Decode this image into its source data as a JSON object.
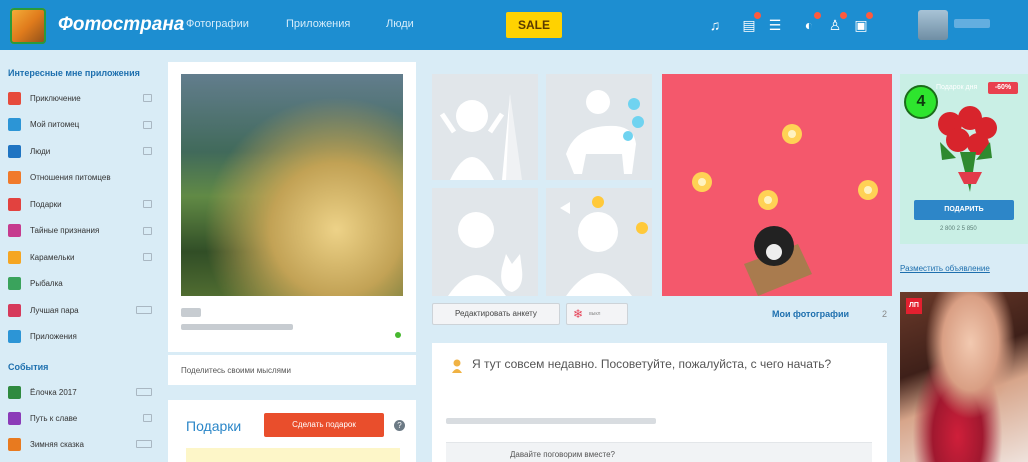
{
  "header": {
    "logo_text": "Фотострана",
    "nav": [
      "Фотографии",
      "Приложения",
      "Люди"
    ],
    "sale_label": "SALE",
    "icons": [
      "music-icon",
      "messages-icon",
      "list-icon",
      "bell-icon",
      "friends-icon",
      "mail-icon"
    ]
  },
  "sidebar": {
    "apps_heading": "Интересные мне приложения",
    "apps": [
      {
        "label": "Приключение",
        "icon_color": "#e64b3c"
      },
      {
        "label": "Мой питомец",
        "icon_color": "#2c95d6"
      },
      {
        "label": "Люди",
        "icon_color": "#1f74c2"
      },
      {
        "label": "Отношения питомцев",
        "icon_color": "#f07a2b"
      },
      {
        "label": "Подарки",
        "icon_color": "#e2423f"
      },
      {
        "label": "Тайные признания",
        "icon_color": "#c63b8e"
      },
      {
        "label": "Карамельки",
        "icon_color": "#f5a623"
      },
      {
        "label": "Рыбалка",
        "icon_color": "#3aa35c"
      },
      {
        "label": "Лучшая пара",
        "icon_color": "#d63a5b"
      },
      {
        "label": "Приложения",
        "icon_color": "#2c95d6"
      }
    ],
    "events_heading": "События",
    "events": [
      {
        "label": "Ёлочка 2017",
        "icon_color": "#2f8a3f"
      },
      {
        "label": "Путь к славе",
        "icon_color": "#8b3bb8"
      },
      {
        "label": "Зимняя сказка",
        "icon_color": "#e87a1f"
      }
    ]
  },
  "profile": {
    "share_prompt": "Поделитесь своими мыслями",
    "gifts_title": "Подарки",
    "make_gift_button": "Сделать подарок",
    "help_icon": "?"
  },
  "photos": {
    "edit_profile_button": "Редактировать анкету",
    "edit_mini_label": "выкл",
    "my_photos_link": "Мои фотографии",
    "my_photos_count": "2"
  },
  "feed": {
    "message": "Я тут совсем недавно. Посоветуйте, пожалуйста, с чего начать?",
    "inner_prompt": "Давайте поговорим вместе?"
  },
  "promo": {
    "title": "Подарок дня",
    "discount": "-60%",
    "step_number": "4",
    "present_button": "ПОДАРИТЬ",
    "price": "2 800 2 5 850",
    "ad_link": "Разместить объявление",
    "ad_logo": "ЛП"
  },
  "colors": {
    "topbar": "#1d8ed1",
    "accent_orange": "#e94e2c",
    "pink_tile": "#f4586c",
    "link_blue": "#1d6fae"
  }
}
